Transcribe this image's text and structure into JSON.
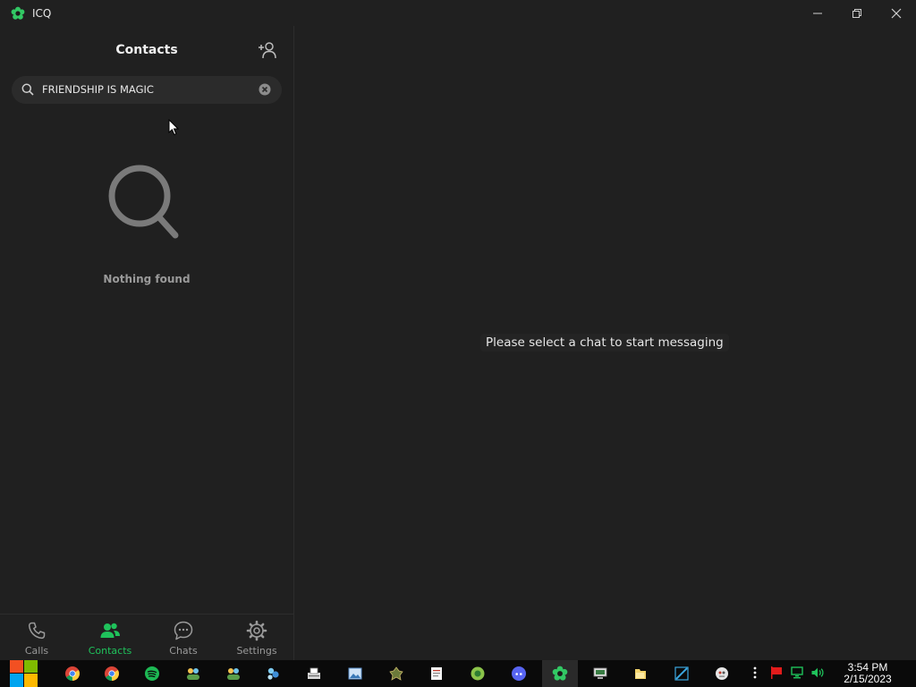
{
  "window": {
    "title": "ICQ"
  },
  "sidebar": {
    "title": "Contacts",
    "search": {
      "value": "FRIENDSHIP IS MAGIC",
      "placeholder": ""
    },
    "empty_state": {
      "icon": "magnifier-icon",
      "text": "Nothing found"
    },
    "nav": [
      {
        "label": "Calls",
        "icon": "phone-icon",
        "active": false
      },
      {
        "label": "Contacts",
        "icon": "contacts-icon",
        "active": true
      },
      {
        "label": "Chats",
        "icon": "chat-icon",
        "active": false
      },
      {
        "label": "Settings",
        "icon": "gear-icon",
        "active": false
      }
    ]
  },
  "main": {
    "placeholder": "Please select a chat to start messaging"
  },
  "taskbar": {
    "apps": [
      "chrome",
      "chrome",
      "spotify",
      "people",
      "people",
      "messenger",
      "scanner",
      "photo-viewer",
      "game",
      "document",
      "browser",
      "discord",
      "icq",
      "remote-desktop",
      "files",
      "sketch",
      "bot"
    ],
    "time": "3:54 PM",
    "date": "2/15/2023"
  },
  "colors": {
    "accent": "#1fc25b",
    "background": "#202020",
    "muted": "#9a9a9a"
  }
}
